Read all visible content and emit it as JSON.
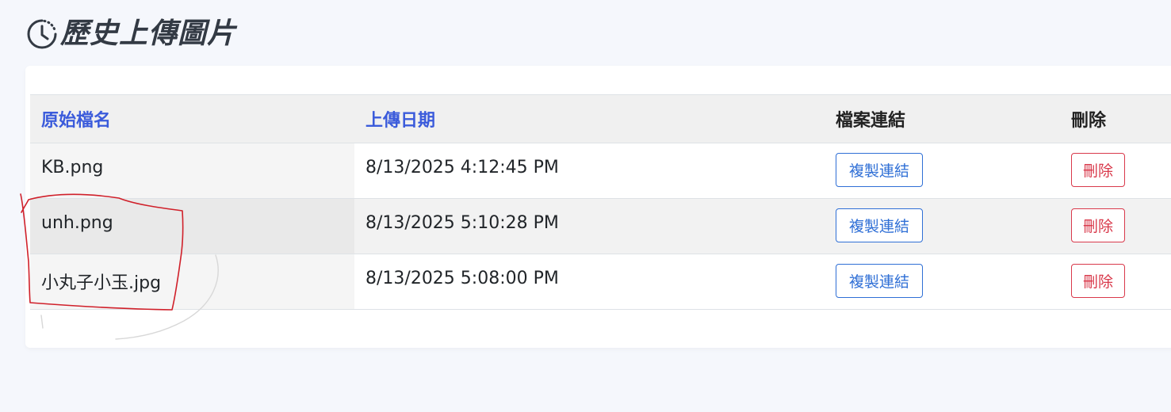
{
  "header": {
    "icon": "history-clock-icon",
    "title": "歷史上傳圖片"
  },
  "table": {
    "columns": [
      {
        "label": "原始檔名",
        "sortable": true
      },
      {
        "label": "上傳日期",
        "sortable": true
      },
      {
        "label": "檔案連結",
        "sortable": false
      },
      {
        "label": "刪除",
        "sortable": false
      }
    ],
    "rows": [
      {
        "filename": "KB.png",
        "date": "8/13/2025 4:12:45 PM",
        "copy_label": "複製連結",
        "delete_label": "刪除"
      },
      {
        "filename": "unh.png",
        "date": "8/13/2025 5:10:28 PM",
        "copy_label": "複製連結",
        "delete_label": "刪除"
      },
      {
        "filename": "小丸子小玉.jpg",
        "date": "8/13/2025 5:08:00 PM",
        "copy_label": "複製連結",
        "delete_label": "刪除"
      }
    ]
  },
  "colors": {
    "sortable_header": "#3b5bdb",
    "copy_button": "#2f6fd6",
    "delete_button": "#d9394b",
    "annotation_stroke": "#d0202a"
  }
}
